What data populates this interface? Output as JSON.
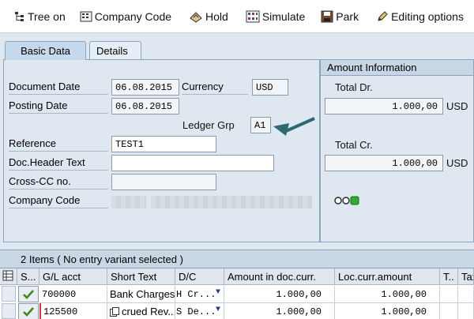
{
  "toolbar": {
    "tree_on": "Tree on",
    "company_code": "Company Code",
    "hold": "Hold",
    "simulate": "Simulate",
    "park": "Park",
    "editing_options": "Editing options"
  },
  "tabs": {
    "basic_data": "Basic Data",
    "details": "Details"
  },
  "form": {
    "document_date_label": "Document Date",
    "document_date": "06.08.2015",
    "posting_date_label": "Posting Date",
    "posting_date": "06.08.2015",
    "currency_label": "Currency",
    "currency": "USD",
    "ledger_grp_label": "Ledger Grp",
    "ledger_grp": "A1",
    "reference_label": "Reference",
    "reference": "TEST1",
    "doc_header_label": "Doc.Header Text",
    "doc_header": "",
    "cross_cc_label": "Cross-CC no.",
    "cross_cc": "",
    "company_code_label": "Company Code"
  },
  "amount_info": {
    "title": "Amount Information",
    "total_dr_label": "Total Dr.",
    "total_dr": "1.000,00",
    "total_dr_currency": "USD",
    "total_cr_label": "Total Cr.",
    "total_cr": "1.000,00",
    "total_cr_currency": "USD"
  },
  "items": {
    "header": "2 Items ( No entry variant selected )",
    "columns": [
      "S...",
      "G/L acct",
      "Short Text",
      "D/C",
      "Amount in doc.curr.",
      "Loc.curr.amount",
      "T..",
      "Tax"
    ],
    "rows": [
      {
        "gl_acct": "700000",
        "short_text": "Bank Charges",
        "dc": "H Cr...",
        "amount_doc": "1.000,00",
        "amount_loc": "1.000,00"
      },
      {
        "gl_acct": "125500",
        "short_text": "crued Rev...",
        "dc": "S De...",
        "amount_doc": "1.000,00",
        "amount_loc": "1.000,00"
      }
    ]
  },
  "colors": {
    "accent": "#2a6b73",
    "status_green": "#2fae2f",
    "panel_bg": "#dfe8f1"
  }
}
